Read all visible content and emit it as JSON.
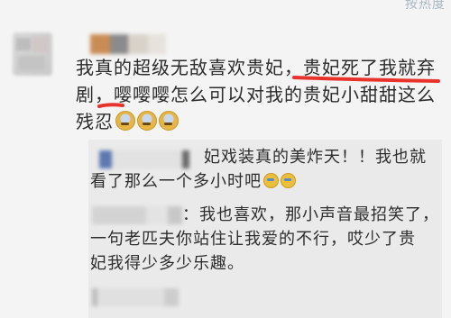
{
  "header": {
    "sort_label": "按热度"
  },
  "comment": {
    "lines": [
      "我真的超级无敌喜欢贵妃，贵妃死了我就弃",
      "剧，嘤嘤嘤怎么可以对我的贵妃小甜甜这么",
      "残忍"
    ],
    "emoji": [
      "crying-face-icon",
      "crying-face-icon",
      "crying-face-icon"
    ]
  },
  "replies": [
    {
      "line1": "妃戏装真的美炸天！！我也就",
      "line2": "看了那么一个多小时吧",
      "emoji": [
        "thumbs-icon",
        "thumbs-icon"
      ]
    },
    {
      "line1": "：我也喜欢，那小声音最招笑了，",
      "line2": "一句老匹夫你站住让我爱的不行，哎少了贵",
      "line3": "妃我得少多少乐趣。"
    }
  ],
  "colors": {
    "highlight": "#e8322c",
    "text": "#2b2b2b",
    "reply_bg": "#eaeaea",
    "link": "#a9b6c6"
  }
}
